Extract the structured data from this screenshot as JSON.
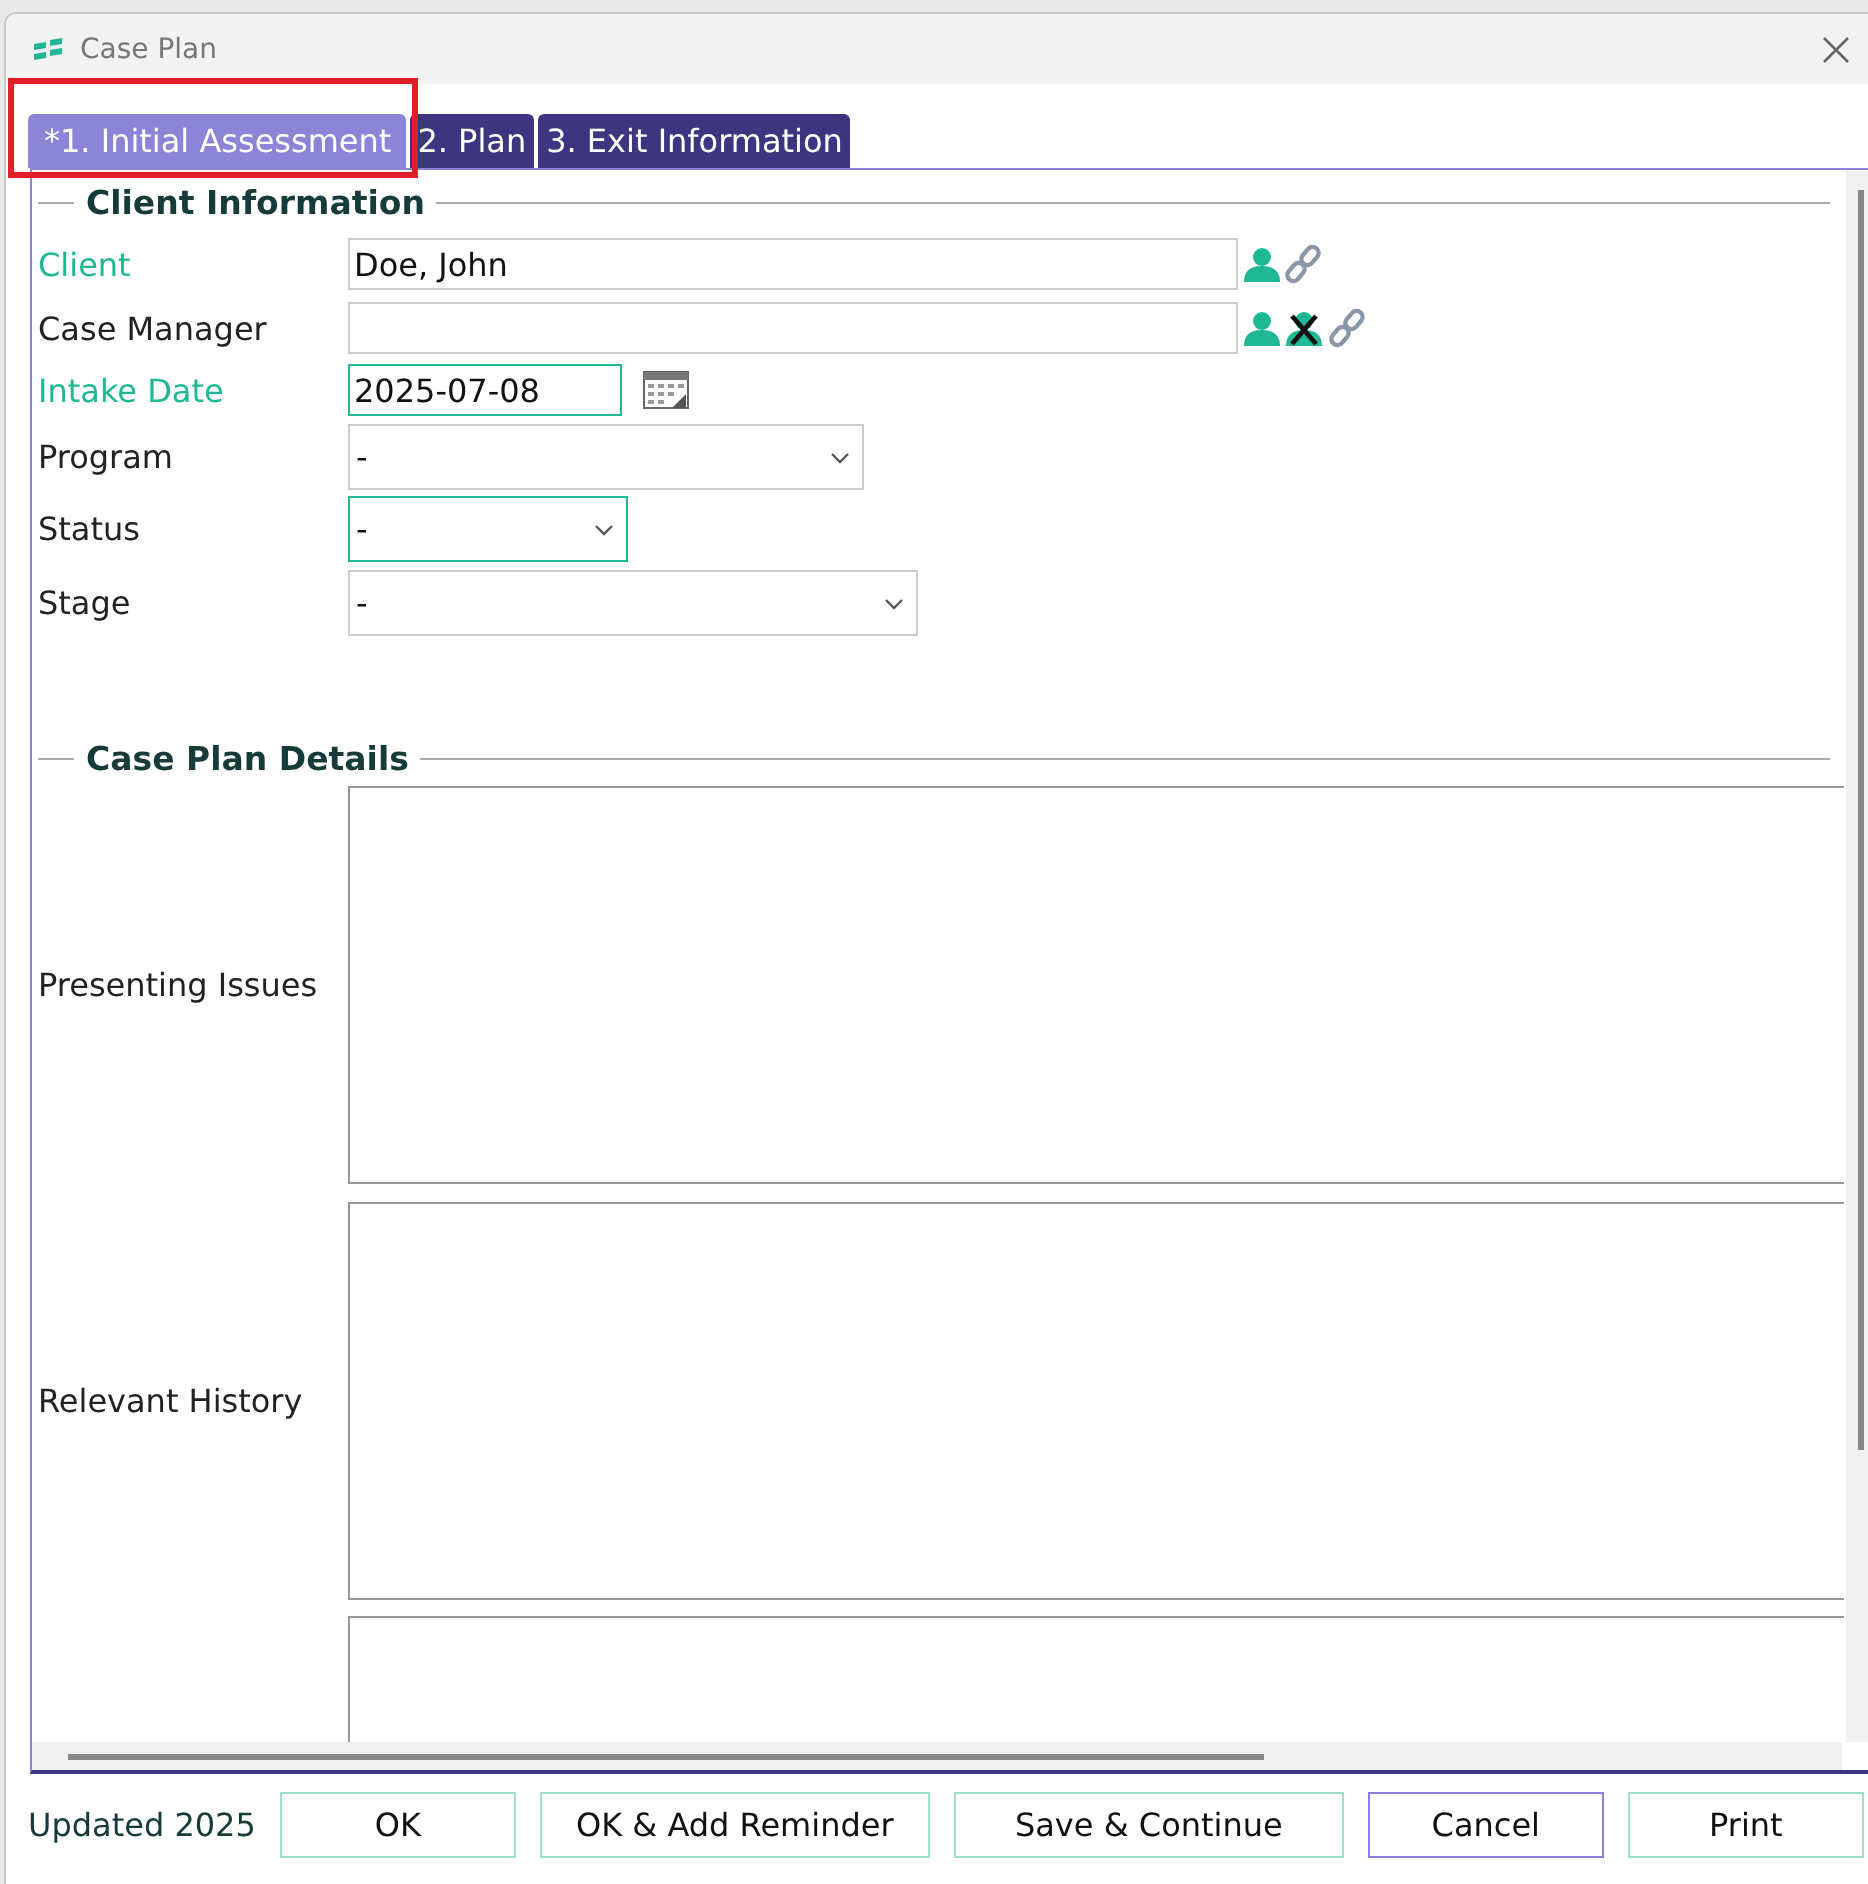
{
  "window": {
    "title": "Case Plan"
  },
  "tabs": [
    {
      "label": "*1. Initial Assessment",
      "selected": true
    },
    {
      "label": "2. Plan",
      "selected": false
    },
    {
      "label": "3. Exit Information",
      "selected": false
    }
  ],
  "client_information": {
    "title": "Client Information",
    "fields": [
      {
        "label": "Client",
        "kind": "lookup",
        "required": true,
        "highlighted": false,
        "value": "Doe, John",
        "clearable": false
      },
      {
        "label": "Case Manager",
        "kind": "lookup",
        "required": false,
        "highlighted": false,
        "clearable": true
      },
      {
        "label": "Intake Date",
        "kind": "date",
        "required": true,
        "highlighted": true,
        "value": "2025-07-08"
      },
      {
        "label": "Program",
        "kind": "select",
        "required": false,
        "highlighted": false,
        "value": "-"
      },
      {
        "label": "Status",
        "kind": "select",
        "required": false,
        "highlighted": true,
        "value": "-"
      },
      {
        "label": "Stage",
        "kind": "select",
        "required": false,
        "highlighted": false,
        "value": "-"
      }
    ]
  },
  "case_plan_details": {
    "title": "Case Plan Details",
    "fields": [
      {
        "label": "Presenting Issues",
        "kind": "textarea"
      },
      {
        "label": "Relevant History",
        "kind": "textarea"
      },
      {
        "kind": "textarea"
      }
    ]
  },
  "status_bar": {
    "text": "Updated 2025"
  },
  "buttons": [
    {
      "label": "OK",
      "color": "#9ee0cc"
    },
    {
      "label": "OK & Add Reminder",
      "color": "#9ee0cc"
    },
    {
      "label": "Save & Continue",
      "color": "#9ee0cc"
    },
    {
      "label": "Cancel",
      "color": "#8a80e0"
    },
    {
      "label": "Print",
      "color": "#9ee0cc"
    }
  ]
}
